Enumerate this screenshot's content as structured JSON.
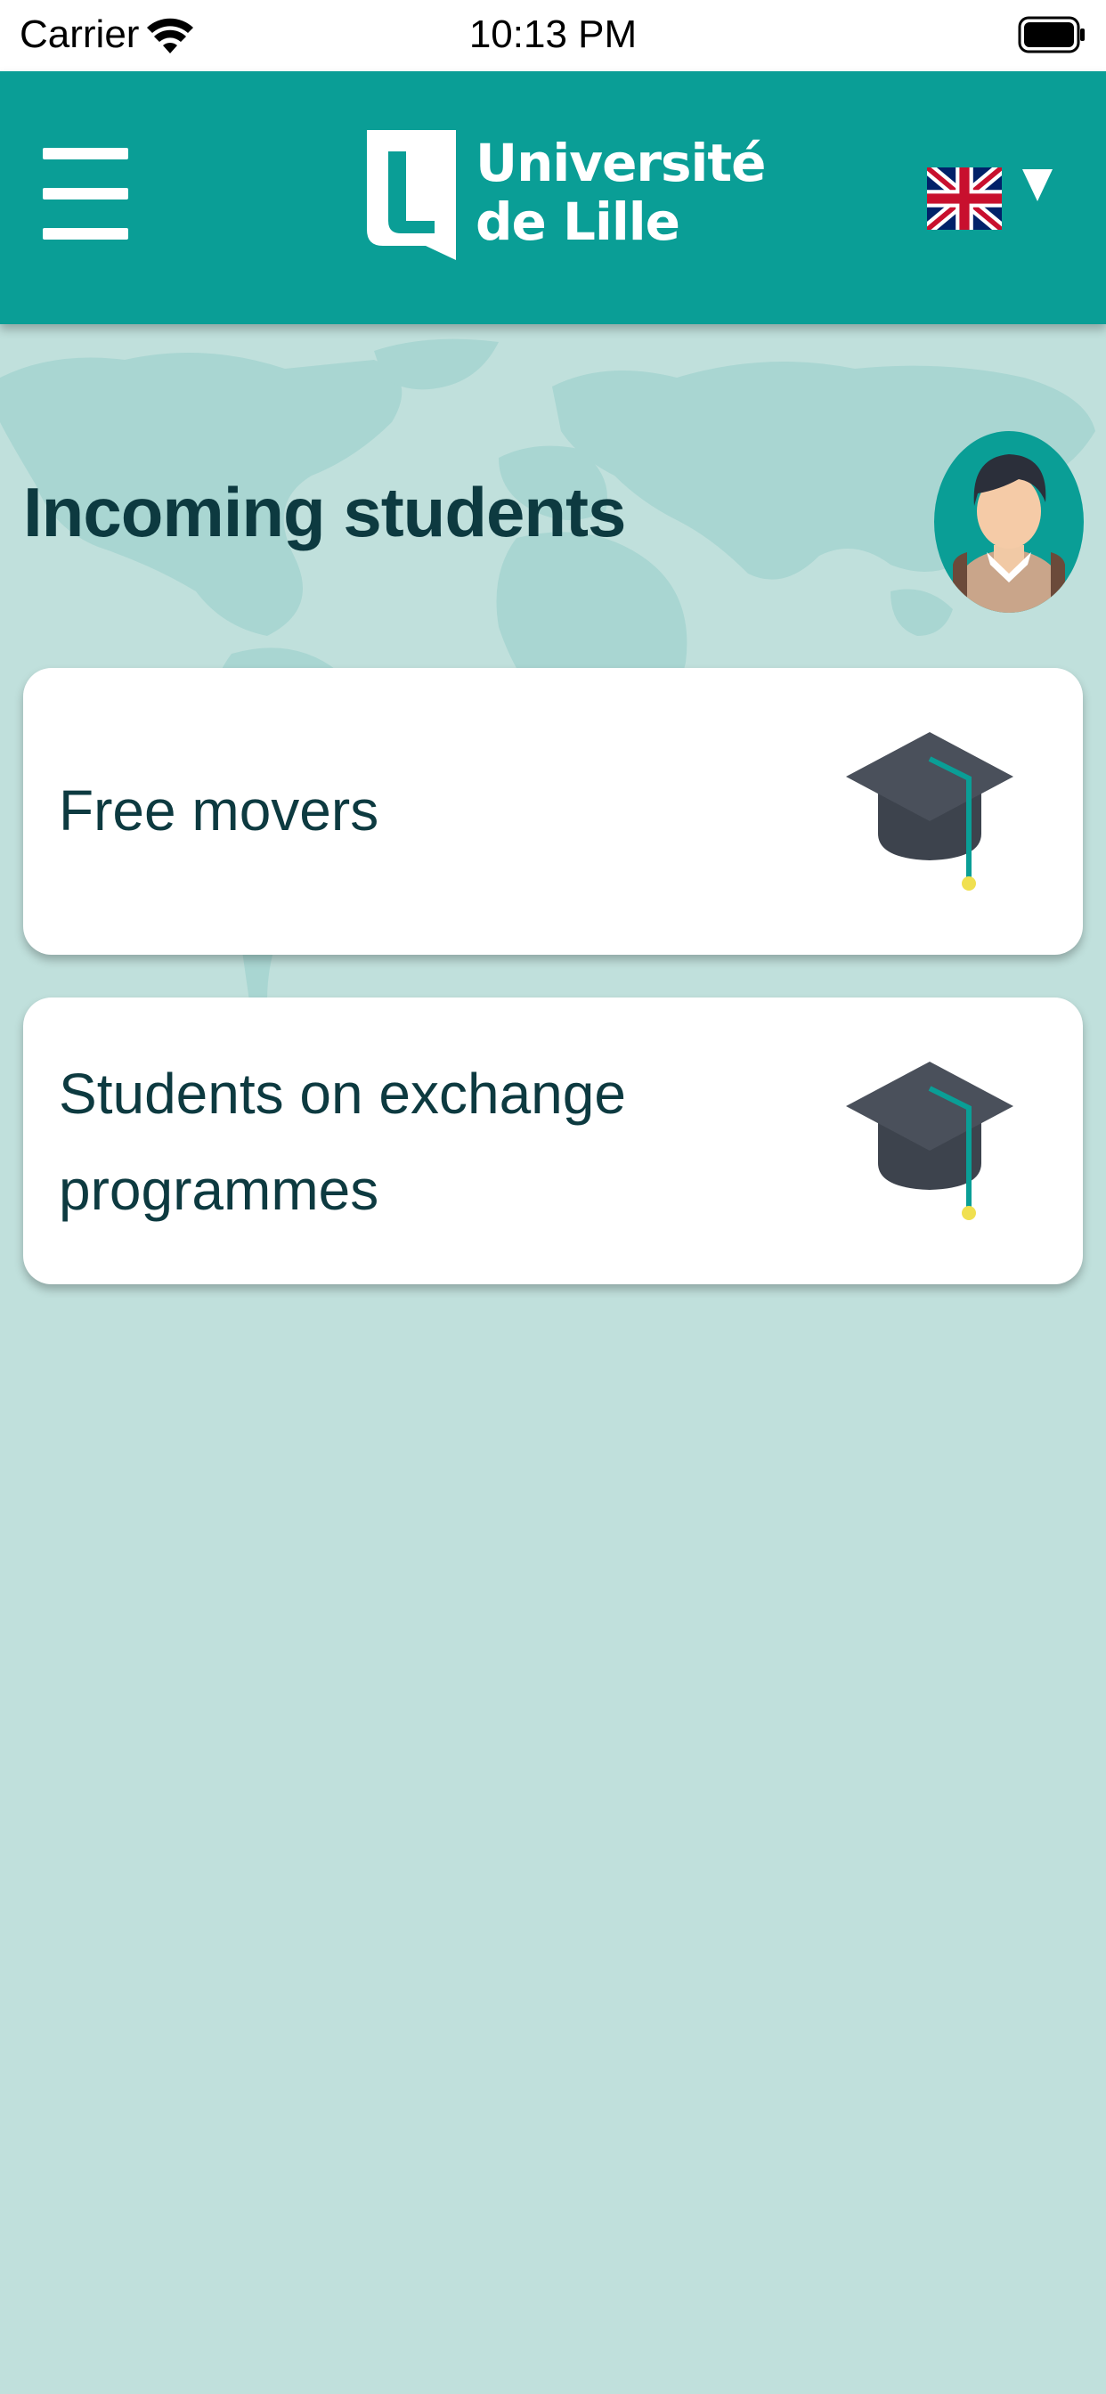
{
  "status_bar": {
    "carrier": "Carrier",
    "time": "10:13 PM"
  },
  "header": {
    "logo_line1": "Université",
    "logo_line2": "de Lille",
    "language_icon": "uk-flag-icon"
  },
  "page": {
    "title": "Incoming students"
  },
  "cards": [
    {
      "label": "Free movers",
      "icon": "graduation-cap-icon"
    },
    {
      "label_line1": "Students on exchange",
      "label_line2": "programmes",
      "icon": "graduation-cap-icon"
    }
  ],
  "colors": {
    "header": "#0a9e96",
    "background": "#c0e0dc",
    "text_dark": "#0d3a40",
    "card": "#ffffff"
  }
}
